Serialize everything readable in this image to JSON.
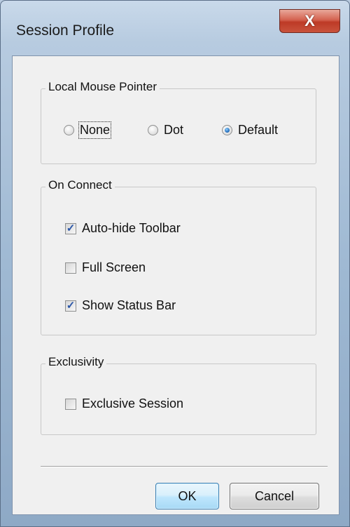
{
  "window": {
    "title": "Session Profile",
    "close_glyph": "X"
  },
  "mouse_pointer": {
    "legend": "Local Mouse Pointer",
    "options": [
      {
        "label": "None",
        "checked": false
      },
      {
        "label": "Dot",
        "checked": false
      },
      {
        "label": "Default",
        "checked": true
      }
    ]
  },
  "on_connect": {
    "legend": "On Connect",
    "options": [
      {
        "label": "Auto-hide Toolbar",
        "checked": true
      },
      {
        "label": "Full Screen",
        "checked": false
      },
      {
        "label": "Show Status Bar",
        "checked": true
      }
    ]
  },
  "exclusivity": {
    "legend": "Exclusivity",
    "options": [
      {
        "label": "Exclusive Session",
        "checked": false
      }
    ]
  },
  "buttons": {
    "ok": "OK",
    "cancel": "Cancel"
  },
  "icons": {
    "close": "close-icon",
    "check": "checkmark-icon"
  },
  "colors": {
    "accent": "#1a63b3",
    "close_button": "#c9523c",
    "checkmark": "#2a56a8"
  }
}
